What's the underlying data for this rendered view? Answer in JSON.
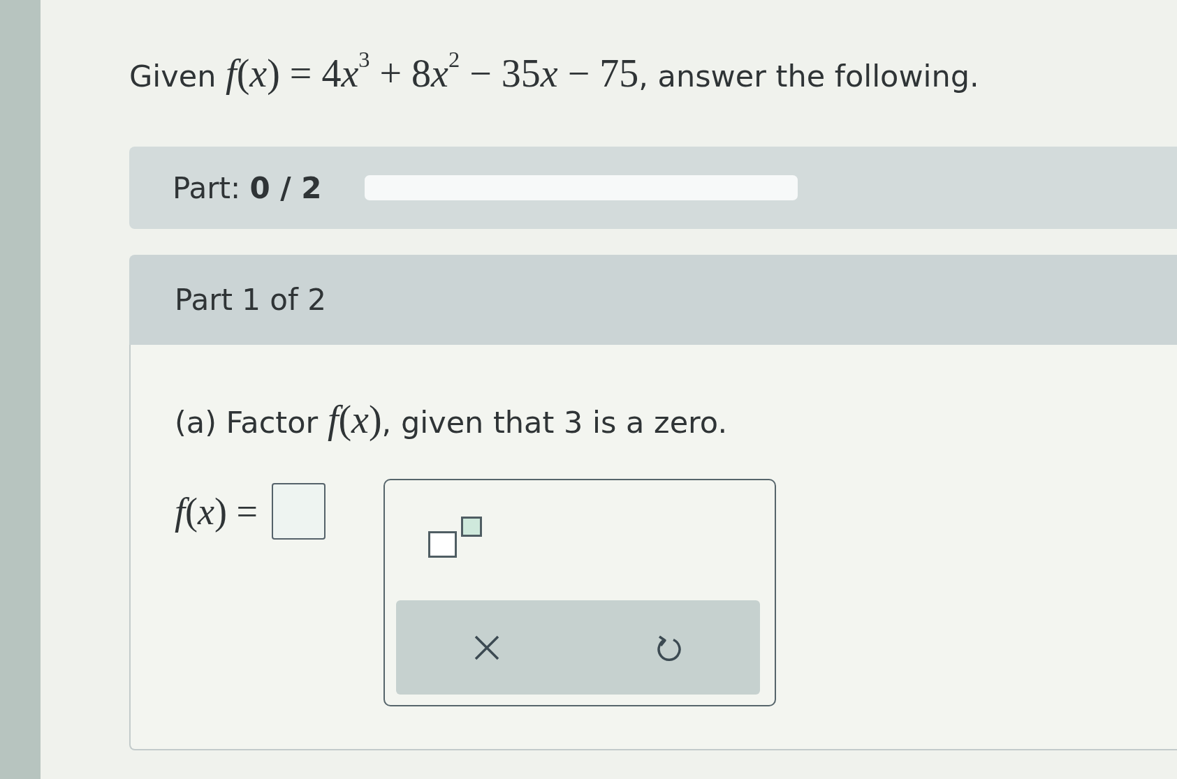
{
  "question": {
    "segments": [
      {
        "kind": "text",
        "text": "Given "
      },
      {
        "kind": "math",
        "text": "*f*(*x*) = 4"
      },
      {
        "kind": "math",
        "text": "*x*$^{3}$ + 8"
      },
      {
        "kind": "math",
        "text": "*x*$^{2}$ − 35"
      },
      {
        "kind": "math",
        "text": "*x* − 75"
      },
      {
        "kind": "text",
        "text": ", answer the following."
      }
    ]
  },
  "progress": {
    "label": "Part: **0 / 2**"
  },
  "part": {
    "header": "Part 1 of 2",
    "prompt": [
      {
        "kind": "text",
        "text": "(a) Factor "
      },
      {
        "kind": "math",
        "text": "*f*(*x*)"
      },
      {
        "kind": "text",
        "text": ", given that 3 is a zero."
      }
    ],
    "answer": {
      "label": "*f*(*x*) ="
    }
  }
}
